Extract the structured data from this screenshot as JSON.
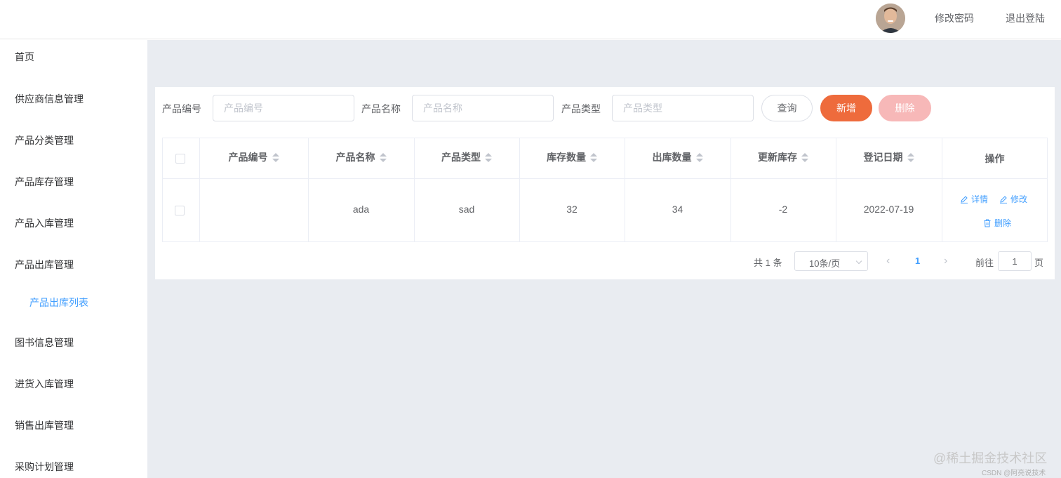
{
  "header": {
    "change_password": "修改密码",
    "logout": "退出登陆"
  },
  "sidebar": {
    "items": [
      {
        "label": "首页"
      },
      {
        "label": "供应商信息管理"
      },
      {
        "label": "产品分类管理"
      },
      {
        "label": "产品库存管理"
      },
      {
        "label": "产品入库管理"
      },
      {
        "label": "产品出库管理"
      },
      {
        "label": "产品出库列表"
      },
      {
        "label": "图书信息管理"
      },
      {
        "label": "进货入库管理"
      },
      {
        "label": "销售出库管理"
      },
      {
        "label": "采购计划管理"
      }
    ]
  },
  "filters": {
    "code_label": "产品编号",
    "code_placeholder": "产品编号",
    "name_label": "产品名称",
    "name_placeholder": "产品名称",
    "type_label": "产品类型",
    "type_placeholder": "产品类型"
  },
  "buttons": {
    "query": "查询",
    "add": "新增",
    "delete": "删除"
  },
  "table": {
    "columns": [
      "产品编号",
      "产品名称",
      "产品类型",
      "库存数量",
      "出库数量",
      "更新库存",
      "登记日期",
      "操作"
    ],
    "rows": [
      {
        "code": "",
        "name": "ada",
        "type": "sad",
        "stock": "32",
        "out": "34",
        "updated": "-2",
        "date": "2022-07-19"
      }
    ],
    "actions": {
      "detail": "详情",
      "edit": "修改",
      "delete": "删除"
    }
  },
  "pagination": {
    "total": "共 1 条",
    "page_size": "10条/页",
    "current_page": "1",
    "goto": "前往",
    "goto_value": "1",
    "page_suffix": "页"
  },
  "watermark": {
    "main": "@稀土掘金技术社区",
    "sub": "CSDN @阿亮说技术"
  }
}
